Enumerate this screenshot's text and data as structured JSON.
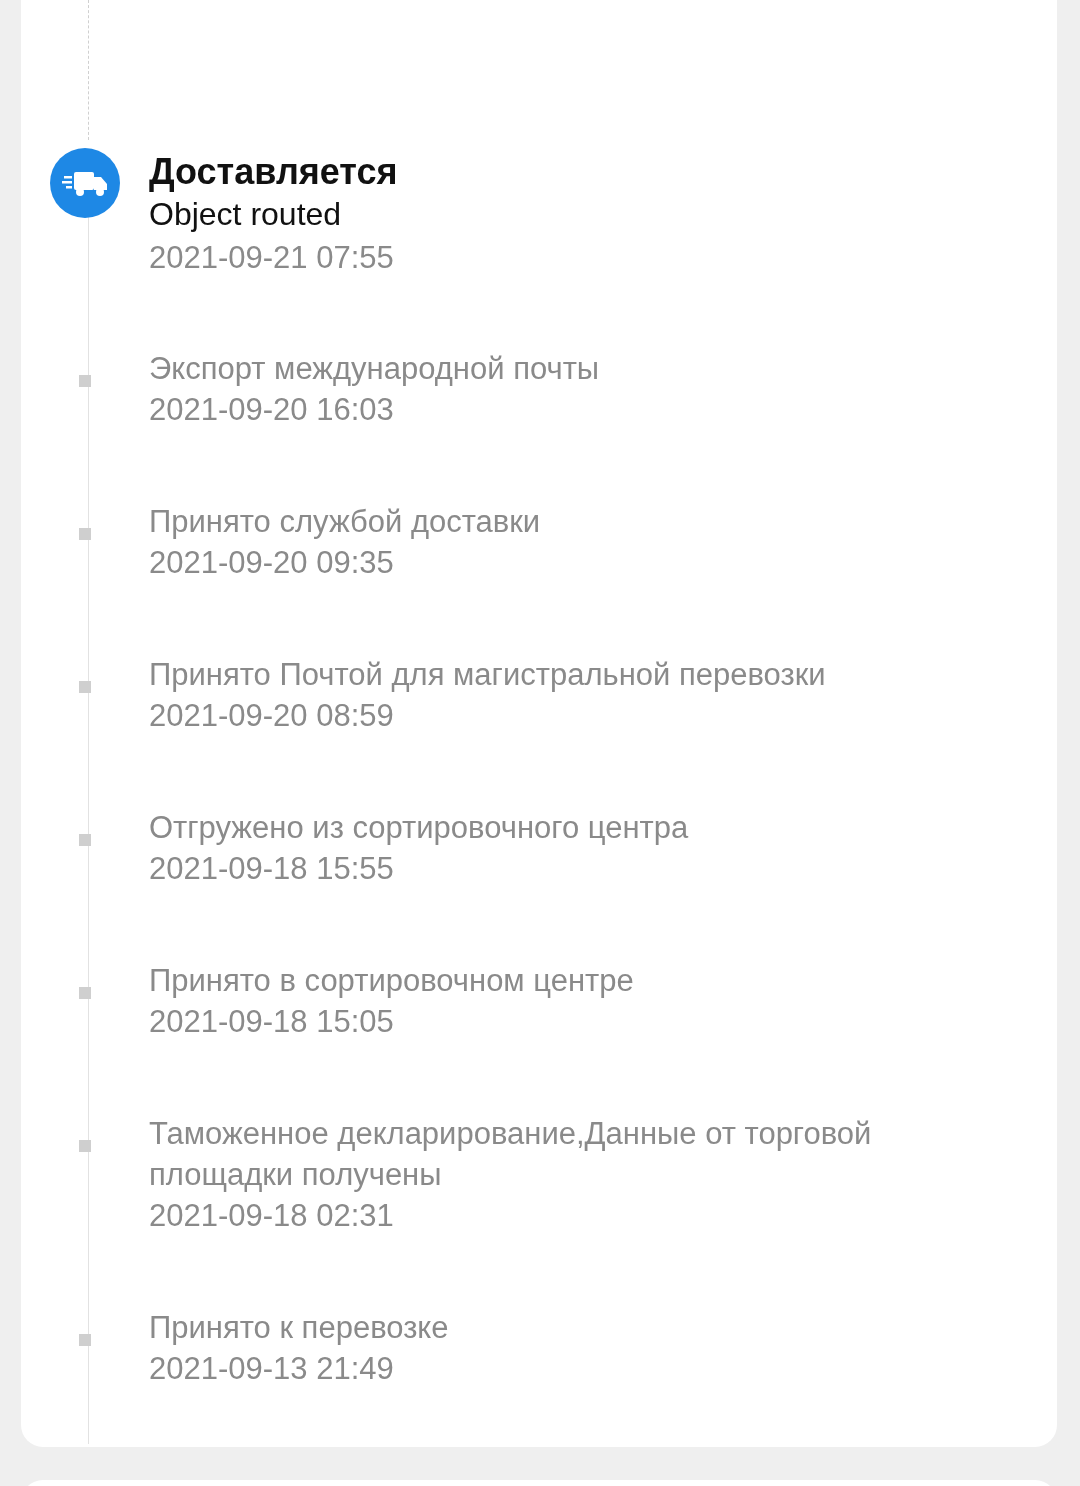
{
  "events": [
    {
      "kind": "current",
      "title": "Доставляется",
      "description": "Object routed",
      "time": "2021-09-21 07:55"
    },
    {
      "kind": "past",
      "description": "Экспорт международной почты",
      "time": "2021-09-20 16:03"
    },
    {
      "kind": "past",
      "description": "Принято службой доставки",
      "time": "2021-09-20 09:35"
    },
    {
      "kind": "past",
      "description": "Принято Почтой для магистральной перевозки",
      "time": "2021-09-20 08:59"
    },
    {
      "kind": "past",
      "description": "Отгружено из сортировочного центра",
      "time": "2021-09-18 15:55"
    },
    {
      "kind": "past",
      "description": "Принято в сортировочном центре",
      "time": "2021-09-18 15:05"
    },
    {
      "kind": "past",
      "description": "Таможенное декларирование,Данные от торговой площадки получены",
      "time": "2021-09-18 02:31"
    },
    {
      "kind": "past",
      "description": "Принято к перевозке",
      "time": "2021-09-13 21:49"
    }
  ]
}
